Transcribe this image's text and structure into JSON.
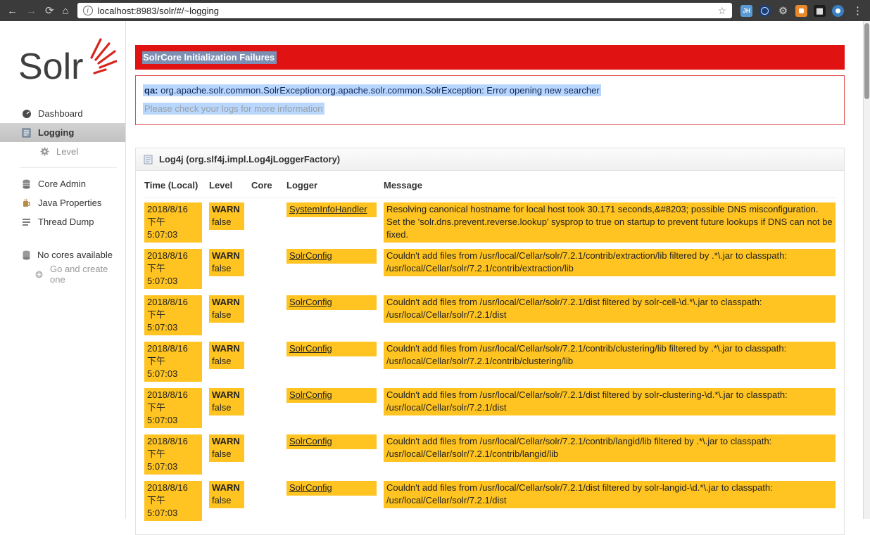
{
  "browser": {
    "url": "localhost:8983/solr/#/~logging",
    "glyphs": {
      "back": "←",
      "forward": "→",
      "reload": "⟳",
      "home": "⌂",
      "star": "☆",
      "menu": "⋮",
      "info": "i",
      "gear": "⚙",
      "qr": "▦",
      "extension_badge": "JH"
    }
  },
  "sidebar": {
    "logo_text": "Solr",
    "items": {
      "dashboard": "Dashboard",
      "logging": "Logging",
      "level": "Level",
      "core_admin": "Core Admin",
      "java_properties": "Java Properties",
      "thread_dump": "Thread Dump"
    },
    "no_cores": {
      "line1": "No cores available",
      "line2": "Go and create one"
    }
  },
  "alert": {
    "title": "SolrCore Initialization Failures",
    "core": "qa:",
    "exception": "org.apache.solr.common.SolrException:org.apache.solr.common.SolrException: Error opening new searcher",
    "hint": "Please check your logs for more information"
  },
  "logging": {
    "panel_title": "Log4j (org.slf4j.impl.Log4jLoggerFactory)",
    "columns": {
      "time": "Time (Local)",
      "level": "Level",
      "core": "Core",
      "logger": "Logger",
      "message": "Message"
    },
    "rows": [
      {
        "date": "2018/8/16",
        "meridiem": "下午",
        "time": "5:07:03",
        "level": "WARN",
        "flag": "false",
        "core": "",
        "logger": "SystemInfoHandler",
        "message": "Resolving canonical hostname for local host took 30.171 seconds,&#8203; possible DNS misconfiguration. Set the 'solr.dns.prevent.reverse.lookup' sysprop to true on startup to prevent future lookups if DNS can not be fixed."
      },
      {
        "date": "2018/8/16",
        "meridiem": "下午",
        "time": "5:07:03",
        "level": "WARN",
        "flag": "false",
        "core": "",
        "logger": "SolrConfig",
        "message": "Couldn't add files from /usr/local/Cellar/solr/7.2.1/contrib/extraction/lib filtered by .*\\.jar to classpath: /usr/local/Cellar/solr/7.2.1/contrib/extraction/lib"
      },
      {
        "date": "2018/8/16",
        "meridiem": "下午",
        "time": "5:07:03",
        "level": "WARN",
        "flag": "false",
        "core": "",
        "logger": "SolrConfig",
        "message": "Couldn't add files from /usr/local/Cellar/solr/7.2.1/dist filtered by solr-cell-\\d.*\\.jar to classpath: /usr/local/Cellar/solr/7.2.1/dist"
      },
      {
        "date": "2018/8/16",
        "meridiem": "下午",
        "time": "5:07:03",
        "level": "WARN",
        "flag": "false",
        "core": "",
        "logger": "SolrConfig",
        "message": "Couldn't add files from /usr/local/Cellar/solr/7.2.1/contrib/clustering/lib filtered by .*\\.jar to classpath: /usr/local/Cellar/solr/7.2.1/contrib/clustering/lib"
      },
      {
        "date": "2018/8/16",
        "meridiem": "下午",
        "time": "5:07:03",
        "level": "WARN",
        "flag": "false",
        "core": "",
        "logger": "SolrConfig",
        "message": "Couldn't add files from /usr/local/Cellar/solr/7.2.1/dist filtered by solr-clustering-\\d.*\\.jar to classpath: /usr/local/Cellar/solr/7.2.1/dist"
      },
      {
        "date": "2018/8/16",
        "meridiem": "下午",
        "time": "5:07:03",
        "level": "WARN",
        "flag": "false",
        "core": "",
        "logger": "SolrConfig",
        "message": "Couldn't add files from /usr/local/Cellar/solr/7.2.1/contrib/langid/lib filtered by .*\\.jar to classpath: /usr/local/Cellar/solr/7.2.1/contrib/langid/lib"
      },
      {
        "date": "2018/8/16",
        "meridiem": "下午",
        "time": "5:07:03",
        "level": "WARN",
        "flag": "false",
        "core": "",
        "logger": "SolrConfig",
        "message": "Couldn't add files from /usr/local/Cellar/solr/7.2.1/dist filtered by solr-langid-\\d.*\\.jar to classpath: /usr/local/Cellar/solr/7.2.1/dist"
      }
    ]
  },
  "colors": {
    "warn_highlight": "#ffc421",
    "banner_red": "#e01212",
    "selection_blue": "#b9d7fd",
    "logo_red": "#d9261c"
  }
}
